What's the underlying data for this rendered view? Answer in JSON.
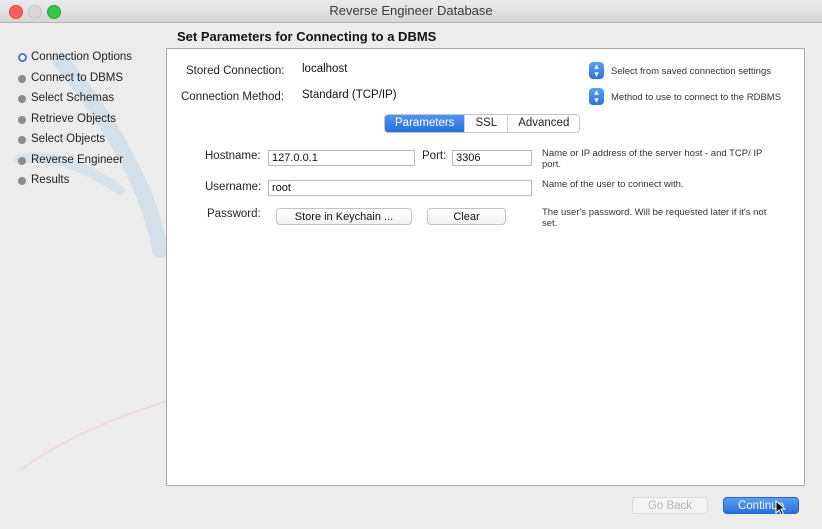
{
  "window": {
    "title": "Reverse Engineer Database"
  },
  "steps": [
    {
      "label": "Connection Options",
      "active": true
    },
    {
      "label": "Connect to DBMS"
    },
    {
      "label": "Select Schemas"
    },
    {
      "label": "Retrieve Objects"
    },
    {
      "label": "Select Objects"
    },
    {
      "label": "Reverse Engineer"
    },
    {
      "label": "Results"
    }
  ],
  "page": {
    "title": "Set Parameters for Connecting to a DBMS"
  },
  "stored_connection": {
    "label": "Stored Connection:",
    "value": "localhost",
    "hint": "Select from saved connection settings"
  },
  "connection_method": {
    "label": "Connection Method:",
    "value": "Standard (TCP/IP)",
    "hint": "Method to use to connect to the RDBMS"
  },
  "tabs": [
    "Parameters",
    "SSL",
    "Advanced"
  ],
  "hostname": {
    "label": "Hostname:",
    "value": "127.0.0.1",
    "port_label": "Port:",
    "port_value": "3306",
    "hint": "Name or IP address of the server host - and TCP/ IP port."
  },
  "username": {
    "label": "Username:",
    "value": "root",
    "hint": "Name of the user to connect with."
  },
  "password": {
    "label": "Password:",
    "store_button": "Store in Keychain ...",
    "clear_button": "Clear",
    "hint": "The user's password. Will be requested later if it's not set."
  },
  "footer": {
    "back": "Go Back",
    "continue": "Continue"
  },
  "colors": {
    "accent": "#2f6fde",
    "active_step_ring": "#4a78c4"
  },
  "icons": {
    "select_arrow": "updown-chevron-icon",
    "cursor": "arrow-cursor-icon"
  }
}
